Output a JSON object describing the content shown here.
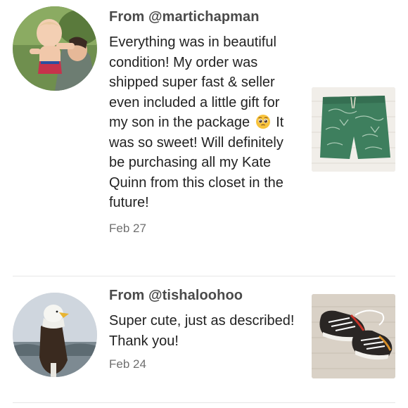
{
  "reviews": [
    {
      "from_label": "From @martichapman",
      "text_before_emoji": "Everything was in beautiful condition! My order was shipped super fast & seller even included a little gift for my son in the package",
      "emoji": "pleading-face-emoji",
      "text_after_emoji": "It was so sweet! Will definitely be purchasing all my Kate Quinn from this closet in the future!",
      "date": "Feb 27",
      "avatar": "mother-and-baby-photo",
      "product_image": "green-patterned-shorts-photo"
    },
    {
      "from_label": "From @tishaloohoo",
      "text": "Super cute, just as described! Thank you!",
      "date": "Feb 24",
      "avatar": "bald-eagle-photo",
      "product_image": "toddler-sneakers-photo"
    }
  ],
  "colors": {
    "background": "#ffffff",
    "heading": "#4a4a4a",
    "body_text": "#222222",
    "date_text": "#6f6f6f",
    "divider": "#e6e6e6"
  }
}
